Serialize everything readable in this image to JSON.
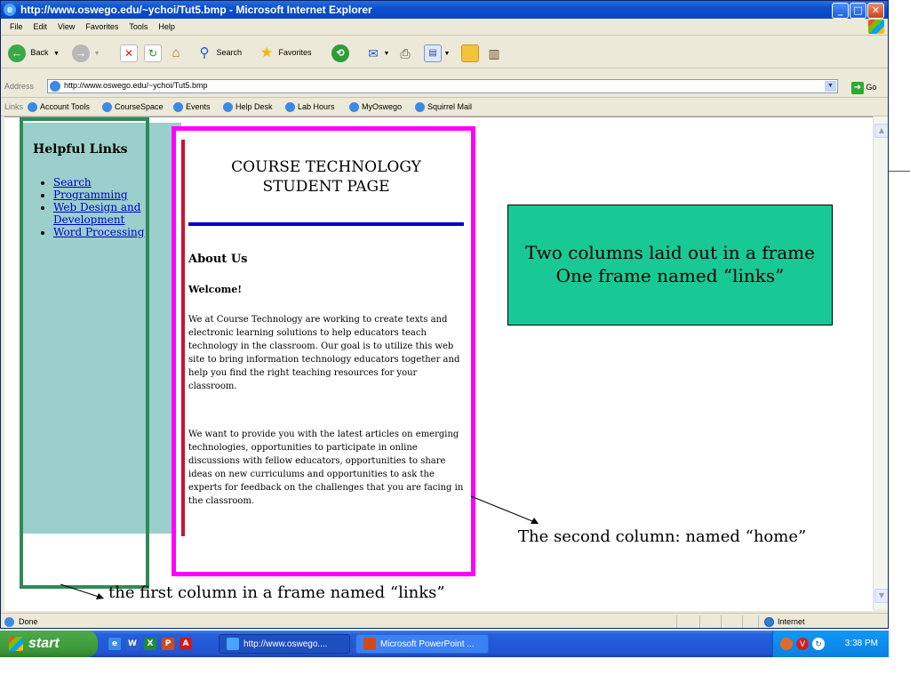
{
  "window": {
    "title": "http://www.oswego.edu/~ychoi/Tut5.bmp - Microsoft Internet Explorer",
    "controls": {
      "minimize": "_",
      "maximize": "□",
      "close": "✕"
    }
  },
  "menu": [
    "File",
    "Edit",
    "View",
    "Favorites",
    "Tools",
    "Help"
  ],
  "toolbar": {
    "back": "Back",
    "search": "Search",
    "favorites": "Favorites"
  },
  "address": {
    "label": "Address",
    "url": "http://www.oswego.edu/~ychoi/Tut5.bmp",
    "go": "Go"
  },
  "links_bar": {
    "label": "Links",
    "items": [
      "Account Tools",
      "CourseSpace",
      "Events",
      "Help Desk",
      "Lab Hours",
      "MyOswego",
      "Squirrel Mail"
    ]
  },
  "links_frame": {
    "heading": "Helpful Links",
    "items": [
      "Search",
      "Programming",
      "Web Design and Development",
      "Word Processing"
    ]
  },
  "home_frame": {
    "heading_line1": "COURSE TECHNOLOGY",
    "heading_line2": "STUDENT PAGE",
    "about": "About Us",
    "welcome": "Welcome!",
    "para1": "We at Course Technology are working to create texts and electronic learning solutions to help educators teach technology in the classroom. Our goal is to utilize this web site to bring information technology educators together and help you find the right teaching resources for your classroom.",
    "para2": "We want to provide you with the latest articles on emerging technologies, opportunities to participate in online discussions with fellow educators, opportunities to share ideas on new curriculums and opportunities to ask the experts for feedback on the challenges that you are facing in the classroom."
  },
  "annotations": {
    "callout_line1": "Two columns laid out in a frame",
    "callout_line2": "One frame named “links”",
    "second_column": "The second column: named “home”",
    "first_column": "the first column in a frame named “links”",
    "callout_color": "#19c995"
  },
  "status": {
    "text": "Done",
    "zone": "Internet"
  },
  "taskbar": {
    "start": "start",
    "tasks": [
      "http://www.oswego....",
      "Microsoft PowerPoint ..."
    ],
    "clock": "3:38 PM"
  },
  "colors": {
    "links_frame_bg": "#9bcfcb",
    "green_outline": "#2e8b57",
    "magenta_outline": "#ff00ff",
    "rule_blue": "#0000cc",
    "bar_red": "#d01030"
  }
}
